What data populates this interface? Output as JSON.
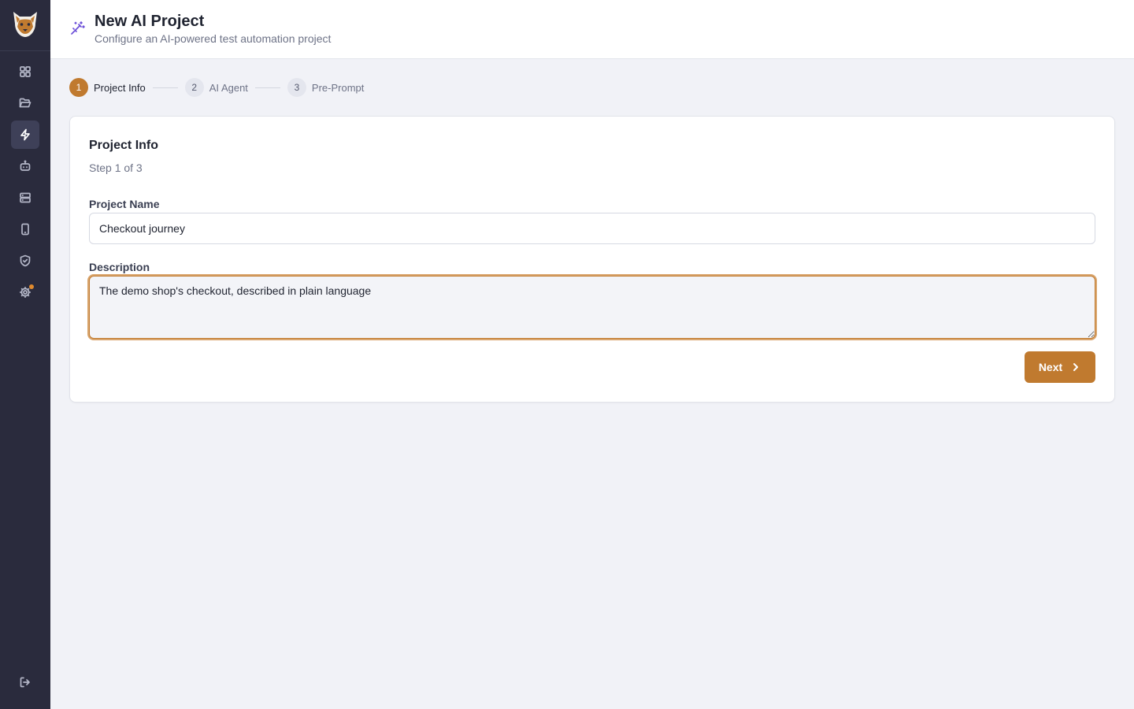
{
  "header": {
    "title": "New AI Project",
    "subtitle": "Configure an AI-powered test automation project",
    "icon": "magic-wand-icon"
  },
  "sidebar": {
    "logo": "fox-logo",
    "items": [
      {
        "icon": "dashboard-grid-icon",
        "active": false
      },
      {
        "icon": "folder-open-icon",
        "active": false
      },
      {
        "icon": "lightning-icon",
        "active": true
      },
      {
        "icon": "robot-icon",
        "active": false
      },
      {
        "icon": "server-icon",
        "active": false
      },
      {
        "icon": "mobile-device-icon",
        "active": false
      },
      {
        "icon": "shield-check-icon",
        "active": false
      },
      {
        "icon": "gear-icon",
        "active": false,
        "notification": true
      }
    ],
    "logout_icon": "logout-icon"
  },
  "stepper": {
    "steps": [
      {
        "number": "1",
        "label": "Project Info",
        "active": true
      },
      {
        "number": "2",
        "label": "AI Agent",
        "active": false
      },
      {
        "number": "3",
        "label": "Pre-Prompt",
        "active": false
      }
    ]
  },
  "form": {
    "title": "Project Info",
    "subtitle": "Step 1 of 3",
    "project_name_label": "Project Name",
    "project_name_value": "Checkout journey",
    "description_label": "Description",
    "description_value": "The demo shop's checkout, described in plain language",
    "next_label": "Next"
  },
  "colors": {
    "accent": "#c07a2f",
    "sidebar_bg": "#2a2b3d",
    "page_bg": "#f1f2f7",
    "header_icon": "#6b4fd8"
  }
}
